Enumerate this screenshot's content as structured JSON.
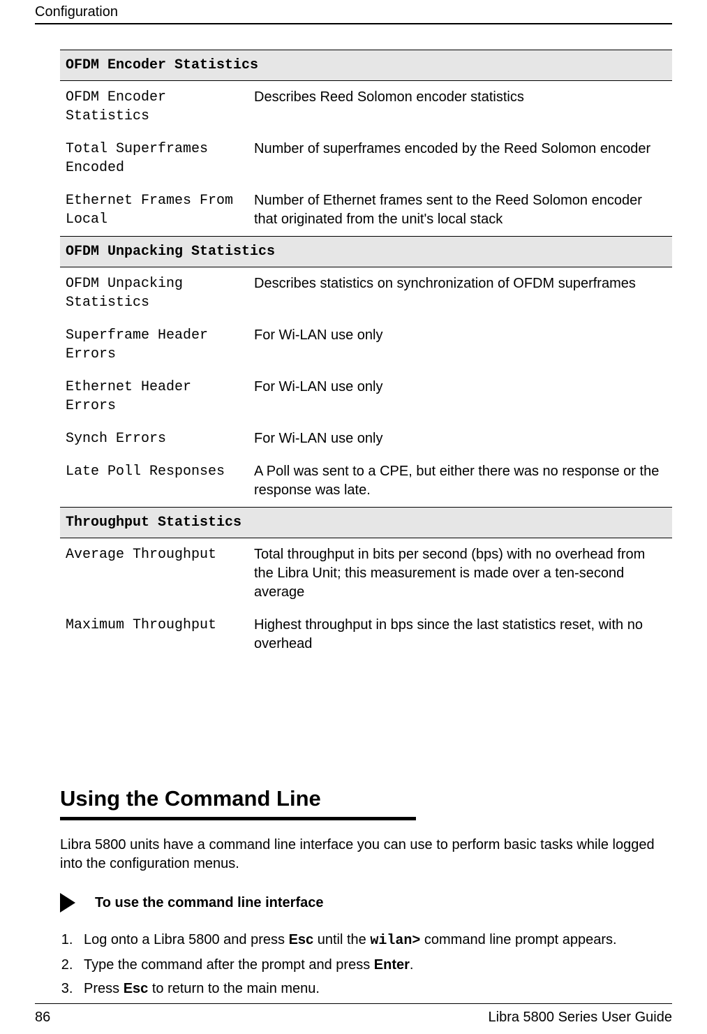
{
  "header": {
    "title": "Configuration"
  },
  "tables": {
    "sections": [
      {
        "heading": "OFDM Encoder Statistics",
        "rows": [
          {
            "label": "OFDM Encoder Statistics",
            "desc": "Describes Reed Solomon encoder statistics"
          },
          {
            "label": "Total Superframes Encoded",
            "desc": "Number of superframes encoded by the Reed Solomon encoder"
          },
          {
            "label": "Ethernet Frames From Local",
            "desc": "Number of Ethernet frames sent to the Reed Solomon encoder that originated from the unit's local stack"
          }
        ]
      },
      {
        "heading": "OFDM Unpacking Statistics",
        "rows": [
          {
            "label": "OFDM Unpacking Statistics",
            "desc": "Describes statistics on synchronization of OFDM superframes"
          },
          {
            "label": "Superframe Header Errors",
            "desc": "For Wi-LAN use only"
          },
          {
            "label": "Ethernet Header Errors",
            "desc": "For Wi-LAN use only"
          },
          {
            "label": "Synch Errors",
            "desc": "For Wi-LAN use only"
          },
          {
            "label": "Late Poll Responses",
            "desc": "A Poll was sent to a CPE, but either there was no response or the response was late."
          }
        ]
      },
      {
        "heading": "Throughput Statistics",
        "rows": [
          {
            "label": "Average Throughput",
            "desc": "Total throughput in bits per second (bps) with no overhead from the Libra Unit; this measurement is made over a ten-second average"
          },
          {
            "label": "Maximum Throughput",
            "desc": "Highest throughput in bps since the last statistics reset, with no overhead"
          }
        ]
      }
    ]
  },
  "section": {
    "title": "Using the Command Line",
    "intro": "Libra 5800 units have a command line interface you can use to perform basic tasks while logged into the configuration menus.",
    "procedure_heading": "To use the command line interface",
    "steps": {
      "s1a": "Log onto a Libra 5800 and press ",
      "s1b": "Esc",
      "s1c": " until the ",
      "s1d": "wilan>",
      "s1e": " command line prompt appears.",
      "s2a": "Type the command after the prompt and press ",
      "s2b": "Enter",
      "s2c": ".",
      "s3a": "Press ",
      "s3b": "Esc",
      "s3c": " to return to the main menu."
    }
  },
  "footer": {
    "page": "86",
    "book": "Libra 5800 Series User Guide"
  }
}
